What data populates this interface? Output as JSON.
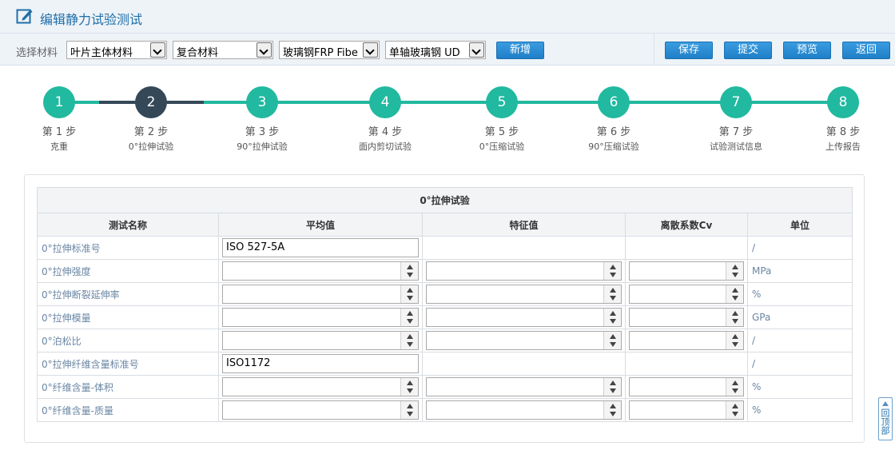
{
  "header": {
    "title": "编辑静力试验测试",
    "icon": "edit-icon"
  },
  "toolbar": {
    "select_label": "选择材料",
    "selects": [
      {
        "value": "叶片主体材料"
      },
      {
        "value": "复合材料"
      },
      {
        "value": "玻璃钢FRP Fibe"
      },
      {
        "value": "单轴玻璃钢 UD"
      }
    ],
    "add_label": "新增",
    "save_label": "保存",
    "submit_label": "提交",
    "preview_label": "预览",
    "back_label": "返回"
  },
  "steps": [
    {
      "num": "1",
      "label": "第 1 步",
      "name": "克重"
    },
    {
      "num": "2",
      "label": "第 2 步",
      "name": "0°拉伸试验"
    },
    {
      "num": "3",
      "label": "第 3 步",
      "name": "90°拉伸试验"
    },
    {
      "num": "4",
      "label": "第 4 步",
      "name": "面内剪切试验"
    },
    {
      "num": "5",
      "label": "第 5 步",
      "name": "0°压缩试验"
    },
    {
      "num": "6",
      "label": "第 6 步",
      "name": "90°压缩试验"
    },
    {
      "num": "7",
      "label": "第 7 步",
      "name": "试验测试信息"
    },
    {
      "num": "8",
      "label": "第 8 步",
      "name": "上传报告"
    }
  ],
  "active_step": 2,
  "table": {
    "caption": "0°拉伸试验",
    "headers": [
      "测试名称",
      "平均值",
      "特征值",
      "离散系数Cv",
      "单位"
    ],
    "rows": [
      {
        "name": "0°拉伸标准号",
        "avg": "ISO 527-5A",
        "unit": "/"
      },
      {
        "name": "0°拉伸强度",
        "unit": "MPa"
      },
      {
        "name": "0°拉伸断裂延伸率",
        "unit": "%"
      },
      {
        "name": "0°拉伸模量",
        "unit": "GPa"
      },
      {
        "name": "0°泊松比",
        "unit": "/"
      },
      {
        "name": "0°拉伸纤维含量标准号",
        "avg": "ISO1172",
        "unit": "/"
      },
      {
        "name": "0°纤维含量-体积",
        "unit": "%"
      },
      {
        "name": "0°纤维含量-质量",
        "unit": "%"
      }
    ]
  },
  "back_to_top": {
    "label": "回顶部"
  },
  "colors": {
    "accent": "#21b99f",
    "active": "#344858",
    "button": "#1f7fc8",
    "title": "#1f6fa8"
  }
}
